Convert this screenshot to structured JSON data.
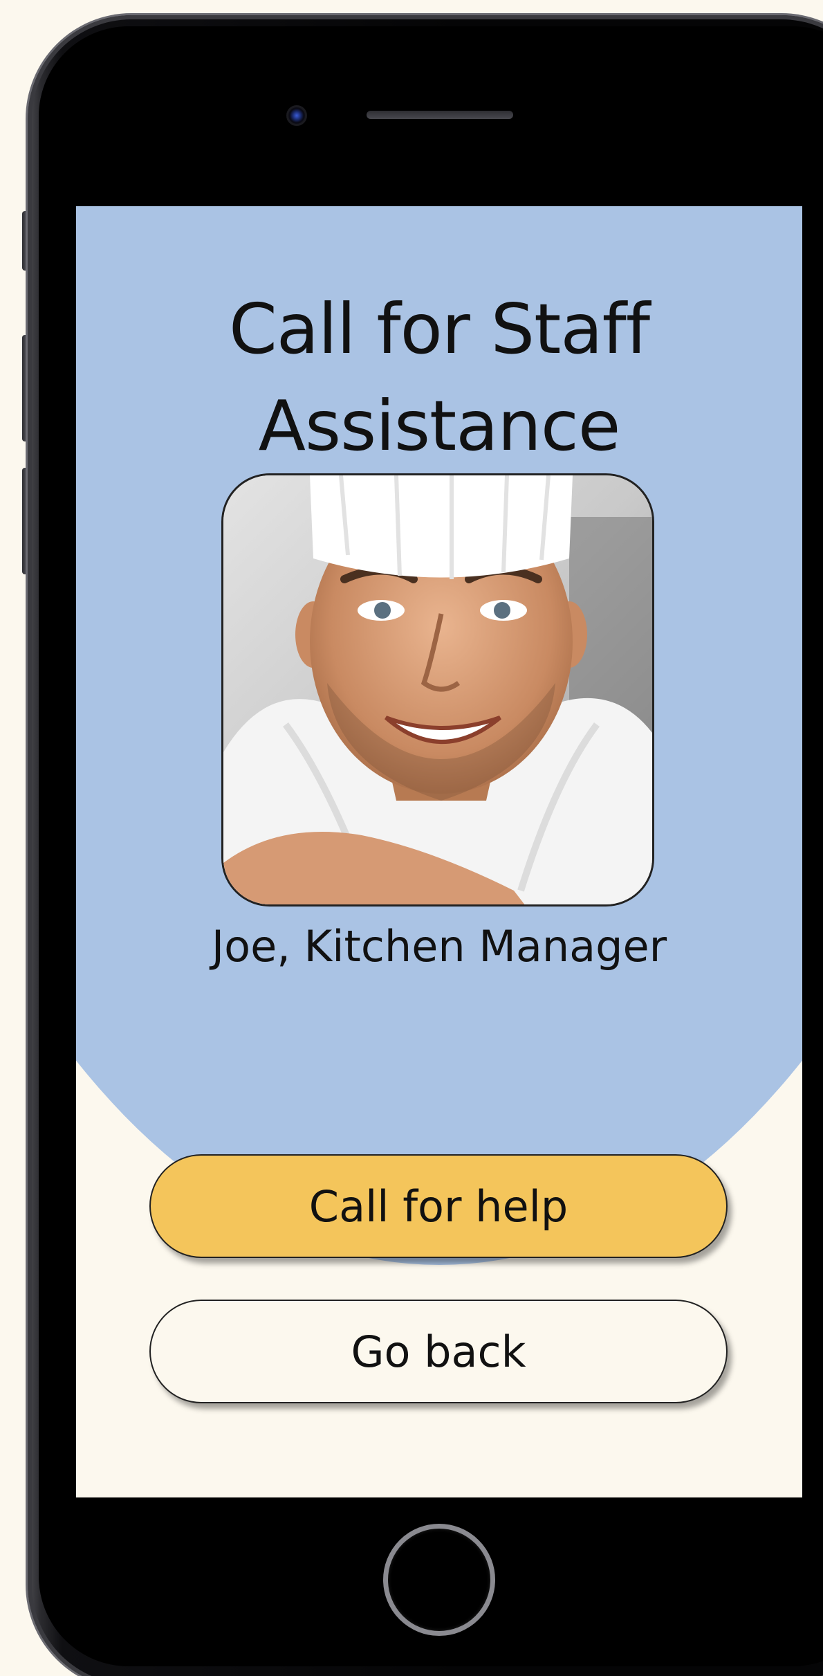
{
  "screen": {
    "title_line1": "Call for Staff",
    "title_line2": "Assistance",
    "staff_name": "Joe, Kitchen Manager",
    "avatar_alt": "Smiling chef wearing a white toque"
  },
  "actions": {
    "call_label": "Call for help",
    "back_label": "Go back"
  },
  "colors": {
    "header_bg": "#aac3e4",
    "page_bg": "#fcf8ee",
    "primary_button": "#f4c55b"
  },
  "icons": {
    "avatar": "chef-photo"
  }
}
